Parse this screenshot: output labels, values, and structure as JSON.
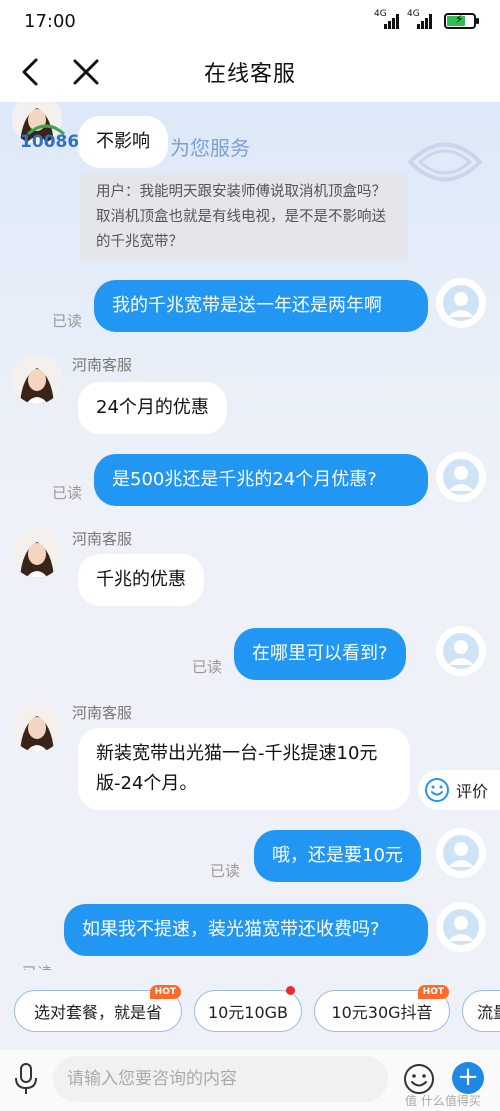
{
  "status": {
    "time": "17:00",
    "net1": "4G",
    "net2": "4G"
  },
  "nav": {
    "title": "在线客服"
  },
  "banner": {
    "logo_text": "10086",
    "subtitle": "为您服务"
  },
  "quote": {
    "text": "用户：我能明天跟安装师傅说取消机顶盒吗？取消机顶盒也就是有线电视，是不是不影响送的千兆宽带？"
  },
  "messages": [
    {
      "side": "left",
      "text": "不影响"
    },
    {
      "side": "right",
      "text": "我的千兆宽带是送一年还是两年啊",
      "read": "已读"
    },
    {
      "side": "left",
      "name": "河南客服",
      "text": "24个月的优惠"
    },
    {
      "side": "right",
      "text": "是500兆还是千兆的24个月优惠?",
      "read": "已读"
    },
    {
      "side": "left",
      "name": "河南客服",
      "text": "千兆的优惠"
    },
    {
      "side": "right",
      "text": "在哪里可以看到?",
      "read": "已读"
    },
    {
      "side": "left",
      "name": "河南客服",
      "text": "新装宽带出光猫一台-千兆提速10元版-24个月。"
    },
    {
      "side": "right",
      "text": "哦，还是要10元",
      "read": "已读"
    },
    {
      "side": "right",
      "text": "如果我不提速，装光猫宽带还收费吗?",
      "read": "已读"
    }
  ],
  "rate": {
    "label": "评价"
  },
  "quick_replies": [
    {
      "label": "选对套餐，就是省",
      "badge": "HOT"
    },
    {
      "label": "10元10GB",
      "badge": "dot"
    },
    {
      "label": "10元30G抖音",
      "badge": "HOT"
    },
    {
      "label": "流量",
      "badge": ""
    }
  ],
  "input": {
    "placeholder": "请输入您要咨询的内容"
  },
  "watermark": "值 什么值得买",
  "colors": {
    "accent": "#2196f3",
    "hot": "#ff6a2a"
  }
}
